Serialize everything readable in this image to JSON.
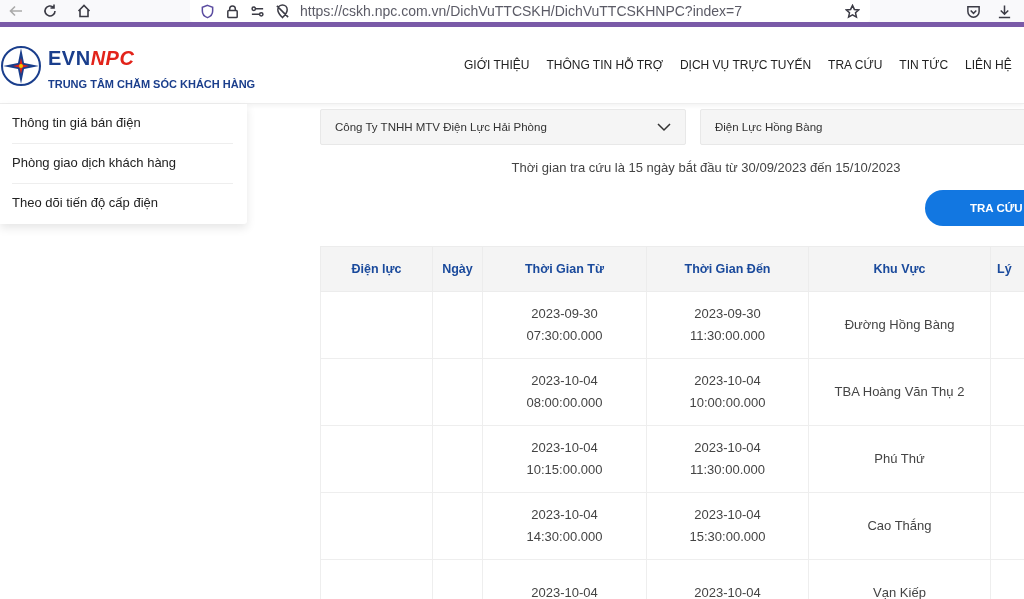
{
  "browser": {
    "url": "https://cskh.npc.com.vn/DichVuTTCSKH/DichVuTTCSKHNPC?index=7"
  },
  "logo": {
    "brand_left": "EVN",
    "brand_right": "NPC",
    "subtitle": "TRUNG TÂM CHĂM SÓC KHÁCH HÀNG"
  },
  "nav": [
    "GIỚI THIỆU",
    "THÔNG TIN HỖ TRỢ",
    "DỊCH VỤ TRỰC TUYẾN",
    "TRA CỨU",
    "TIN TỨC",
    "LIÊN HỆ"
  ],
  "sidebar": {
    "items": [
      "Thông tin giá bán điện",
      "Phòng giao dịch khách hàng",
      "Theo dõi tiến độ cấp điện"
    ]
  },
  "filters": {
    "company": "Công Ty TNHH MTV Điện Lực Hải Phòng",
    "branch": "Điện Lực Hồng Bàng"
  },
  "info": "Thời gian tra cứu là 15 ngày bắt đầu từ 30/09/2023 đến 15/10/2023",
  "search_button": "TRA CỨU",
  "table": {
    "columns": [
      "Điện lực",
      "Ngày",
      "Thời Gian Từ",
      "Thời Gian Đến",
      "Khu Vực",
      "Lý"
    ],
    "rows": [
      {
        "from": [
          "2023-09-30",
          "07:30:00.000"
        ],
        "to": [
          "2023-09-30",
          "11:30:00.000"
        ],
        "area": "Đường Hồng Bàng"
      },
      {
        "from": [
          "2023-10-04",
          "08:00:00.000"
        ],
        "to": [
          "2023-10-04",
          "10:00:00.000"
        ],
        "area": "TBA Hoàng Văn Thụ 2"
      },
      {
        "from": [
          "2023-10-04",
          "10:15:00.000"
        ],
        "to": [
          "2023-10-04",
          "11:30:00.000"
        ],
        "area": "Phú Thứ"
      },
      {
        "from": [
          "2023-10-04",
          "14:30:00.000"
        ],
        "to": [
          "2023-10-04",
          "15:30:00.000"
        ],
        "area": "Cao Thắng"
      },
      {
        "from": [
          "2023-10-04"
        ],
        "to": [
          "2023-10-04"
        ],
        "area": "Vạn Kiếp"
      }
    ]
  }
}
